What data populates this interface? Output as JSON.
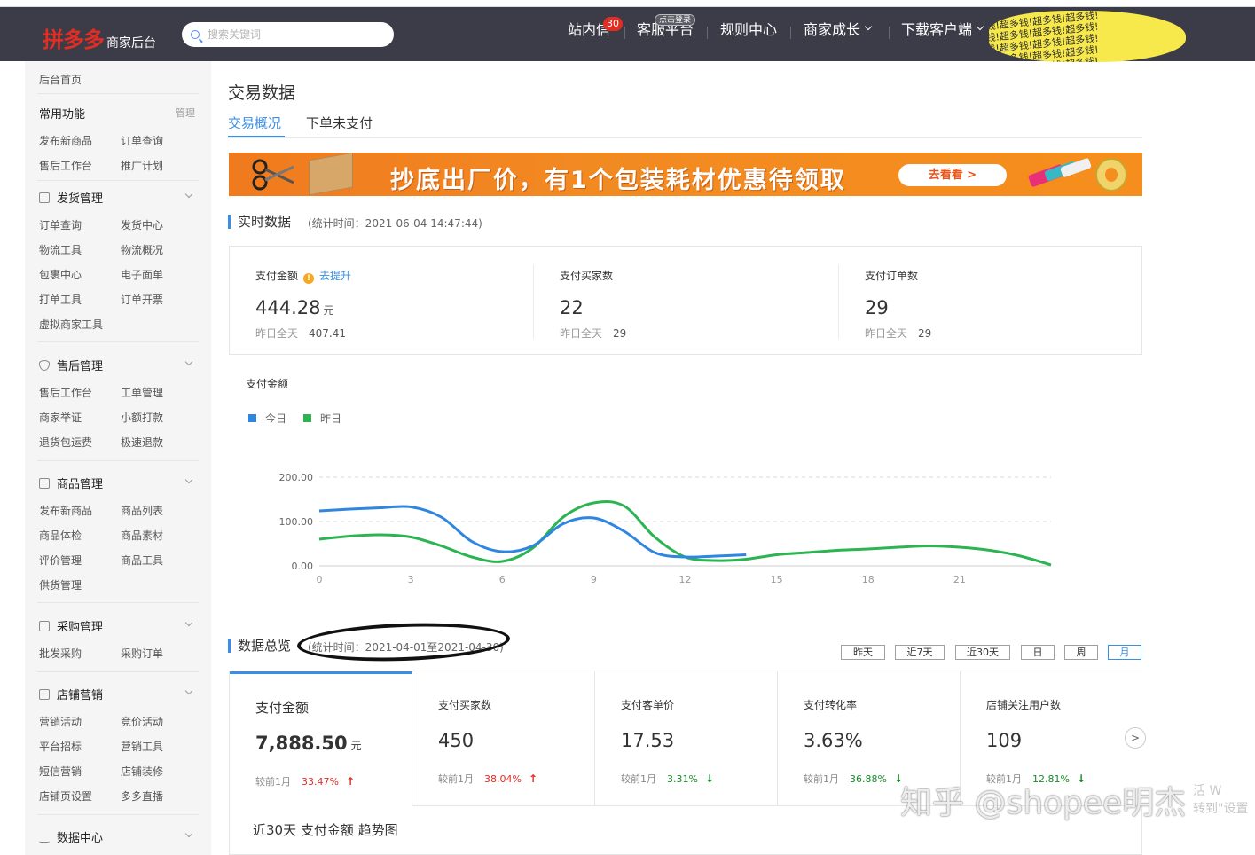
{
  "header": {
    "logo_brand": "拼多多",
    "logo_sub": "商家后台",
    "search_placeholder": "搜索关键词",
    "nav": {
      "inbox": "站内信",
      "inbox_badge": "30",
      "service": "客服平台",
      "service_badge": "点击登录",
      "rules": "规则中心",
      "growth": "商家成长",
      "download": "下载客户端"
    },
    "scribble_text": "钱!超多钱!超多钱!超多钱!"
  },
  "sidebar": {
    "home": "后台首页",
    "common": {
      "title": "常用功能",
      "manage": "管理",
      "items": [
        "发布新商品",
        "订单查询",
        "售后工作台",
        "推广计划"
      ]
    },
    "shipping": {
      "title": "发货管理",
      "items": [
        "订单查询",
        "发货中心",
        "物流工具",
        "物流概况",
        "包裹中心",
        "电子面单",
        "打单工具",
        "订单开票",
        "虚拟商家工具"
      ]
    },
    "aftersale": {
      "title": "售后管理",
      "items": [
        "售后工作台",
        "工单管理",
        "商家举证",
        "小额打款",
        "退货包运费",
        "极速退款"
      ]
    },
    "goods": {
      "title": "商品管理",
      "items": [
        "发布新商品",
        "商品列表",
        "商品体检",
        "商品素材",
        "评价管理",
        "商品工具",
        "供货管理"
      ]
    },
    "purchase": {
      "title": "采购管理",
      "items": [
        "批发采购",
        "采购订单"
      ]
    },
    "marketing": {
      "title": "店铺营销",
      "items": [
        "营销活动",
        "竞价活动",
        "平台招标",
        "营销工具",
        "短信营销",
        "店铺装修",
        "店铺页设置",
        "多多直播"
      ]
    },
    "datacenter": {
      "title": "数据中心"
    }
  },
  "main": {
    "title": "交易数据",
    "tabs": [
      "交易概况",
      "下单未支付"
    ],
    "banner": {
      "text": "抄底出厂价，有1个包装耗材优惠待领取",
      "button": "去看看 >"
    },
    "realtime": {
      "title": "实时数据",
      "time": "(统计时间：2021-06-04 14:47:44)",
      "cards": [
        {
          "label": "支付金额",
          "warn": "!",
          "link": "去提升",
          "value": "444.28",
          "unit": "元",
          "prev_label": "昨日全天",
          "prev_value": "407.41"
        },
        {
          "label": "支付买家数",
          "value": "22",
          "prev_label": "昨日全天",
          "prev_value": "29"
        },
        {
          "label": "支付订单数",
          "value": "29",
          "prev_label": "昨日全天",
          "prev_value": "29"
        }
      ]
    },
    "overview": {
      "title": "数据总览",
      "time": "(统计时间：2021-04-01至2021-04-30)",
      "ranges": [
        "昨天",
        "近7天",
        "近30天",
        "日",
        "周",
        "月"
      ],
      "cards": [
        {
          "label": "支付金额",
          "value": "7,888.50",
          "unit": "元",
          "cmp": "较前1月",
          "pct": "33.47%",
          "dir": "up",
          "arrow": "↑"
        },
        {
          "label": "支付买家数",
          "value": "450",
          "cmp": "较前1月",
          "pct": "38.04%",
          "dir": "up",
          "arrow": "↑"
        },
        {
          "label": "支付客单价",
          "value": "17.53",
          "cmp": "较前1月",
          "pct": "3.31%",
          "dir": "down",
          "arrow": "↓"
        },
        {
          "label": "支付转化率",
          "value": "3.63%",
          "cmp": "较前1月",
          "pct": "36.88%",
          "dir": "down",
          "arrow": "↓"
        },
        {
          "label": "店铺关注用户数",
          "value": "109",
          "cmp": "较前1月",
          "pct": "12.81%",
          "dir": "down",
          "arrow": "↓"
        }
      ],
      "next": ">",
      "trend_title": "近30天 支付金额 趋势图"
    },
    "watermark": "知乎 @shopee明杰",
    "watermark_side": [
      "活 W",
      "转到\"设置"
    ]
  },
  "chart_data": {
    "type": "line",
    "title": "支付金额",
    "x": [
      0,
      1,
      2,
      3,
      4,
      5,
      6,
      7,
      8,
      9,
      10,
      11,
      12,
      13,
      14,
      15,
      16,
      17,
      18,
      19,
      20,
      21,
      22,
      23,
      24
    ],
    "xticks": [
      "0",
      "3",
      "6",
      "9",
      "12",
      "15",
      "18",
      "21"
    ],
    "yticks": [
      "0.00",
      "100.00",
      "200.00"
    ],
    "ylim": [
      0,
      200
    ],
    "legend_position": "top-left",
    "grid": true,
    "series": [
      {
        "name": "今日",
        "color": "#2f86e0",
        "values": [
          124,
          128,
          131,
          133,
          110,
          55,
          32,
          45,
          95,
          108,
          78,
          30,
          20,
          22,
          25
        ]
      },
      {
        "name": "昨日",
        "color": "#2bb451",
        "values": [
          60,
          67,
          70,
          65,
          45,
          20,
          10,
          40,
          110,
          142,
          135,
          65,
          20,
          12,
          15,
          25,
          30,
          35,
          38,
          42,
          45,
          42,
          35,
          22,
          2
        ]
      }
    ]
  }
}
